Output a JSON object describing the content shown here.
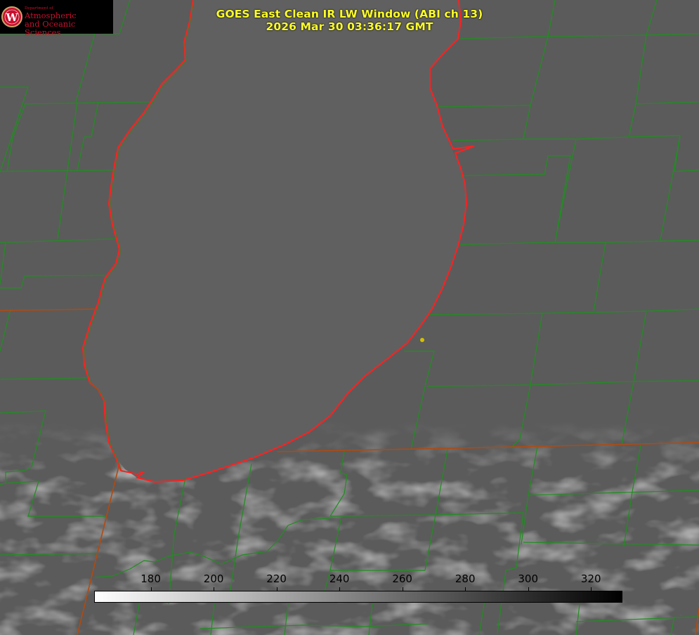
{
  "title": {
    "line1": "GOES East Clean IR LW Window (ABI ch 13)",
    "line2": "2026 Mar 30 03:36:17 GMT"
  },
  "logo": {
    "initial": "W",
    "dept": "Department of",
    "line1": "Atmospheric",
    "line2": "and Oceanic Sciences"
  },
  "colorbar": {
    "min": 162,
    "max": 330,
    "ticks": [
      180,
      200,
      220,
      240,
      260,
      280,
      300,
      320
    ],
    "gradient": "white-to-black"
  },
  "colors": {
    "title_text": "#ffff2a",
    "county_lines": "#1f8f1f",
    "shoreline": "#ff2020",
    "state_border": "#b24a10",
    "station_marker": "#d4c000",
    "background_gray": "#595959",
    "lake_gray": "#606060"
  }
}
